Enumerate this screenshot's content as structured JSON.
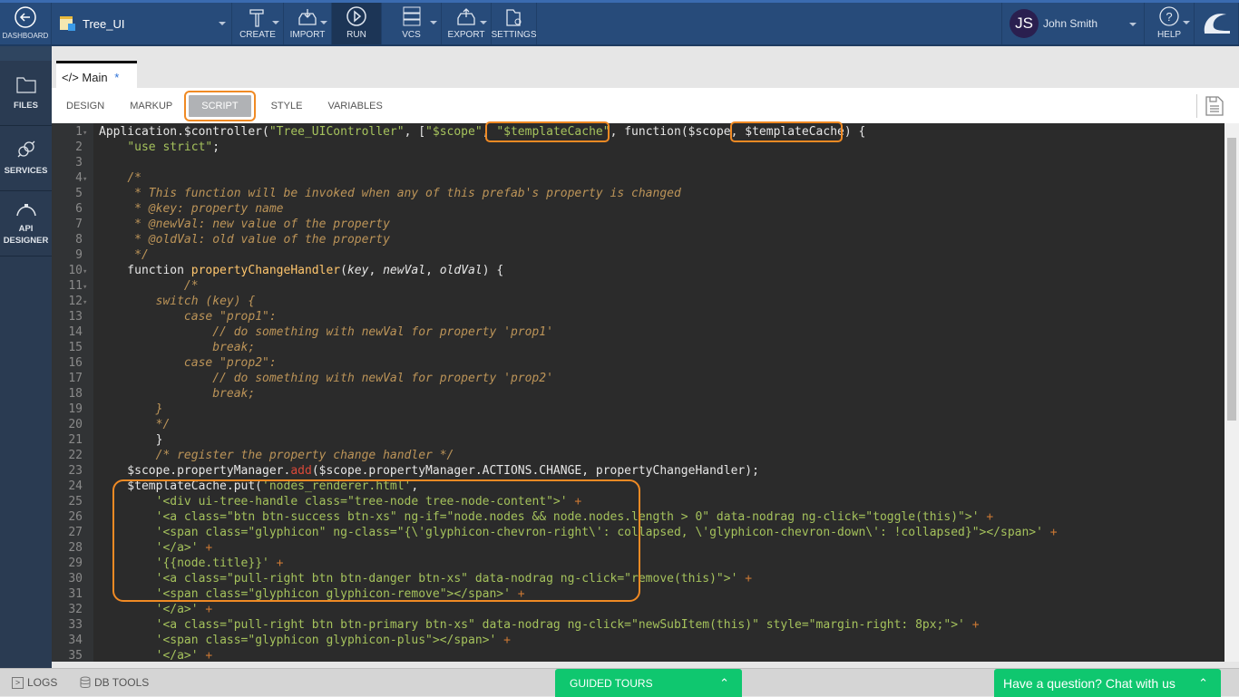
{
  "header": {
    "dashboard": "DASHBOARD",
    "project": "Tree_UI",
    "create": "CREATE",
    "import": "IMPORT",
    "run": "RUN",
    "vcs": "VCS",
    "export": "EXPORT",
    "settings": "SETTINGS",
    "user_initials": "JS",
    "user_name": "John Smith",
    "help": "HELP"
  },
  "sidebar": {
    "items": [
      {
        "label": "FILES",
        "icon": "folder-icon"
      },
      {
        "label": "SERVICES",
        "icon": "plug-icon"
      },
      {
        "label": "API DESIGNER",
        "icon": "bezier-icon"
      }
    ]
  },
  "tab": {
    "label": "Main",
    "modified": "*"
  },
  "subtabs": [
    "DESIGN",
    "MARKUP",
    "SCRIPT",
    "STYLE",
    "VARIABLES"
  ],
  "active_subtab": "SCRIPT",
  "colors": {
    "accent_highlight": "#f08a24",
    "topbar": "#274b7a",
    "green": "#0fc76f"
  },
  "code": [
    [
      [
        "p",
        "Application.$controller("
      ],
      [
        "s",
        "\"Tree_UIController\""
      ],
      [
        "p",
        ", ["
      ],
      [
        "s",
        "\"$scope\""
      ],
      [
        "p",
        ", "
      ],
      [
        "s",
        "\"$templateCache\""
      ],
      [
        "p",
        ", function($scope, $templateCache) {"
      ]
    ],
    [
      [
        "p",
        "    "
      ],
      [
        "s",
        "\"use strict\""
      ],
      [
        "p",
        ";"
      ]
    ],
    [],
    [
      [
        "p",
        "    "
      ],
      [
        "c",
        "/*"
      ]
    ],
    [
      [
        "p",
        "     "
      ],
      [
        "c",
        "* This function will be invoked when any of this prefab's property is changed"
      ]
    ],
    [
      [
        "p",
        "     "
      ],
      [
        "c",
        "* @key: property name"
      ]
    ],
    [
      [
        "p",
        "     "
      ],
      [
        "c",
        "* @newVal: new value of the property"
      ]
    ],
    [
      [
        "p",
        "     "
      ],
      [
        "c",
        "* @oldVal: old value of the property"
      ]
    ],
    [
      [
        "p",
        "     "
      ],
      [
        "c",
        "*/"
      ]
    ],
    [
      [
        "p",
        "    function "
      ],
      [
        "f",
        "propertyChangeHandler"
      ],
      [
        "p",
        "("
      ],
      [
        "i",
        "key"
      ],
      [
        "p",
        ", "
      ],
      [
        "i",
        "newVal"
      ],
      [
        "p",
        ", "
      ],
      [
        "i",
        "oldVal"
      ],
      [
        "p",
        ") {"
      ]
    ],
    [
      [
        "p",
        "            "
      ],
      [
        "c",
        "/*"
      ]
    ],
    [
      [
        "p",
        "        "
      ],
      [
        "c",
        "switch (key) {"
      ]
    ],
    [
      [
        "p",
        "            "
      ],
      [
        "c",
        "case \"prop1\":"
      ]
    ],
    [
      [
        "p",
        "                "
      ],
      [
        "c",
        "// do something with newVal for property 'prop1'"
      ]
    ],
    [
      [
        "p",
        "                "
      ],
      [
        "c",
        "break;"
      ]
    ],
    [
      [
        "p",
        "            "
      ],
      [
        "c",
        "case \"prop2\":"
      ]
    ],
    [
      [
        "p",
        "                "
      ],
      [
        "c",
        "// do something with newVal for property 'prop2'"
      ]
    ],
    [
      [
        "p",
        "                "
      ],
      [
        "c",
        "break;"
      ]
    ],
    [
      [
        "p",
        "        "
      ],
      [
        "c",
        "}"
      ]
    ],
    [
      [
        "p",
        "        "
      ],
      [
        "c",
        "*/"
      ]
    ],
    [
      [
        "p",
        "        }"
      ]
    ],
    [
      [
        "p",
        "        "
      ],
      [
        "c",
        "/* register the property change handler */"
      ]
    ],
    [
      [
        "p",
        "    $scope.propertyManager."
      ],
      [
        "r",
        "add"
      ],
      [
        "p",
        "($scope.propertyManager.ACTIONS.CHANGE, propertyChangeHandler);"
      ]
    ],
    [
      [
        "p",
        "    $templateCache.put("
      ],
      [
        "s",
        "'nodes_renderer.html'"
      ],
      [
        "p",
        ","
      ]
    ],
    [
      [
        "p",
        "        "
      ],
      [
        "s",
        "'<div ui-tree-handle class=\"tree-node tree-node-content\">'"
      ],
      [
        "o",
        " +"
      ]
    ],
    [
      [
        "p",
        "        "
      ],
      [
        "s",
        "'<a class=\"btn btn-success btn-xs\" ng-if=\"node.nodes && node.nodes.length > 0\" data-nodrag ng-click=\"toggle(this)\">'"
      ],
      [
        "o",
        " +"
      ]
    ],
    [
      [
        "p",
        "        "
      ],
      [
        "s",
        "'<span class=\"glyphicon\" ng-class=\"{\\'glyphicon-chevron-right\\': collapsed, \\'glyphicon-chevron-down\\': !collapsed}\"></span>'"
      ],
      [
        "o",
        " +"
      ]
    ],
    [
      [
        "p",
        "        "
      ],
      [
        "s",
        "'</a>'"
      ],
      [
        "o",
        " +"
      ]
    ],
    [
      [
        "p",
        "        "
      ],
      [
        "s",
        "'{{node.title}}'"
      ],
      [
        "o",
        " +"
      ]
    ],
    [
      [
        "p",
        "        "
      ],
      [
        "s",
        "'<a class=\"pull-right btn btn-danger btn-xs\" data-nodrag ng-click=\"remove(this)\">'"
      ],
      [
        "o",
        " +"
      ]
    ],
    [
      [
        "p",
        "        "
      ],
      [
        "s",
        "'<span class=\"glyphicon glyphicon-remove\"></span>'"
      ],
      [
        "o",
        " +"
      ]
    ],
    [
      [
        "p",
        "        "
      ],
      [
        "s",
        "'</a>'"
      ],
      [
        "o",
        " +"
      ]
    ],
    [
      [
        "p",
        "        "
      ],
      [
        "s",
        "'<a class=\"pull-right btn btn-primary btn-xs\" data-nodrag ng-click=\"newSubItem(this)\" style=\"margin-right: 8px;\">'"
      ],
      [
        "o",
        " +"
      ]
    ],
    [
      [
        "p",
        "        "
      ],
      [
        "s",
        "'<span class=\"glyphicon glyphicon-plus\"></span>'"
      ],
      [
        "o",
        " +"
      ]
    ],
    [
      [
        "p",
        "        "
      ],
      [
        "s",
        "'</a>'"
      ],
      [
        "o",
        " +"
      ]
    ]
  ],
  "fold_lines": [
    1,
    4,
    10,
    11,
    12
  ],
  "bottom": {
    "logs": "LOGS",
    "db_tools": "DB TOOLS",
    "guided_tours": "GUIDED TOURS",
    "chat": "Have a question? Chat with us"
  }
}
